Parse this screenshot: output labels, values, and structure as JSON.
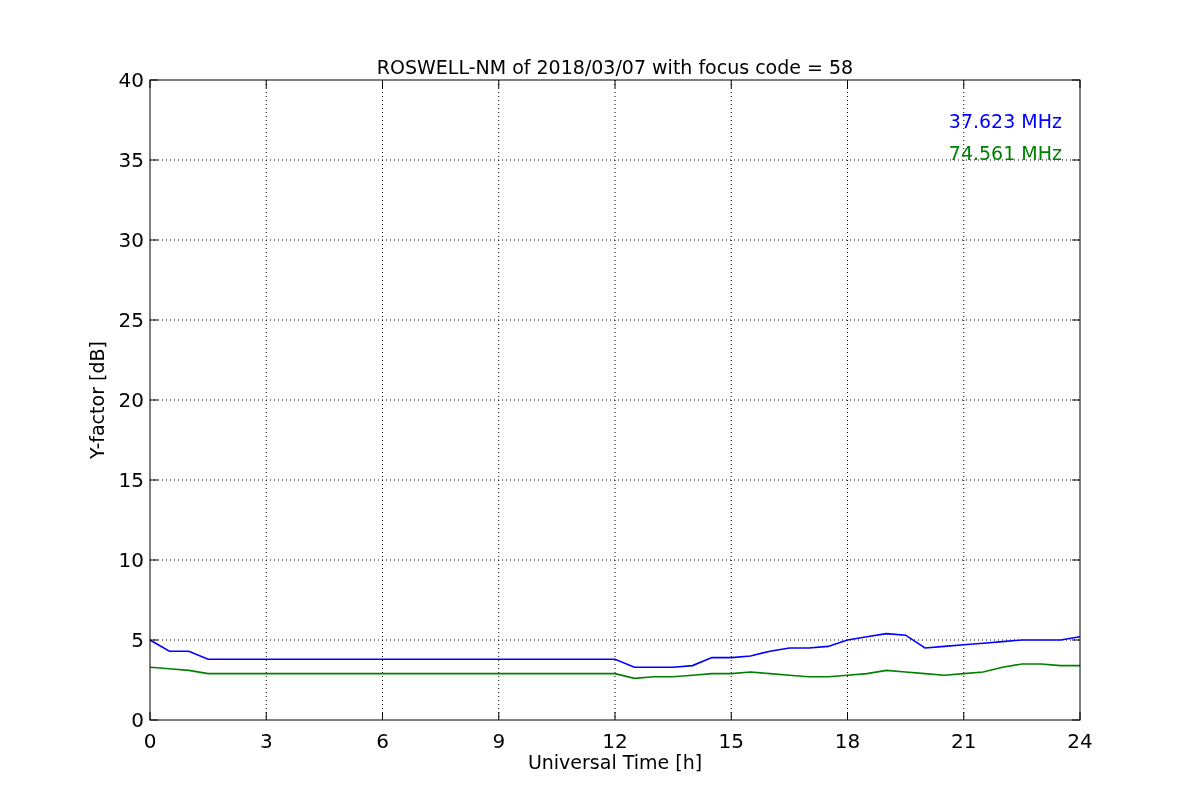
{
  "chart_data": {
    "type": "line",
    "title": "ROSWELL-NM of 2018/03/07 with focus code = 58",
    "xlabel": "Universal Time [h]",
    "ylabel": "Y-factor [dB]",
    "x": [
      0,
      0.5,
      1,
      1.5,
      2,
      2.5,
      3,
      3.5,
      4,
      4.5,
      5,
      5.5,
      6,
      6.5,
      7,
      7.5,
      8,
      8.5,
      9,
      9.5,
      10,
      10.5,
      11,
      11.5,
      12,
      12.5,
      13,
      13.5,
      14,
      14.5,
      15,
      15.5,
      16,
      16.5,
      17,
      17.5,
      18,
      18.5,
      19,
      19.5,
      20,
      20.5,
      21,
      21.5,
      22,
      22.5,
      23,
      23.5,
      24
    ],
    "series": [
      {
        "name": "37.623 MHz",
        "color": "#0000ff",
        "values": [
          5.0,
          4.3,
          4.3,
          3.8,
          3.8,
          3.8,
          3.8,
          3.8,
          3.8,
          3.8,
          3.8,
          3.8,
          3.8,
          3.8,
          3.8,
          3.8,
          3.8,
          3.8,
          3.8,
          3.8,
          3.8,
          3.8,
          3.8,
          3.8,
          3.8,
          3.3,
          3.3,
          3.3,
          3.4,
          3.9,
          3.9,
          4.0,
          4.3,
          4.5,
          4.5,
          4.6,
          5.0,
          5.2,
          5.4,
          5.3,
          4.5,
          4.6,
          4.7,
          4.8,
          4.9,
          5.0,
          5.0,
          5.0,
          5.2
        ]
      },
      {
        "name": "74.561 MHz",
        "color": "#008000",
        "values": [
          3.3,
          3.2,
          3.1,
          2.9,
          2.9,
          2.9,
          2.9,
          2.9,
          2.9,
          2.9,
          2.9,
          2.9,
          2.9,
          2.9,
          2.9,
          2.9,
          2.9,
          2.9,
          2.9,
          2.9,
          2.9,
          2.9,
          2.9,
          2.9,
          2.9,
          2.6,
          2.7,
          2.7,
          2.8,
          2.9,
          2.9,
          3.0,
          2.9,
          2.8,
          2.7,
          2.7,
          2.8,
          2.9,
          3.1,
          3.0,
          2.9,
          2.8,
          2.9,
          3.0,
          3.3,
          3.5,
          3.5,
          3.4,
          3.4
        ]
      }
    ],
    "xlim": [
      0,
      24
    ],
    "ylim": [
      0,
      40
    ],
    "grid": true,
    "xticks": [
      0,
      3,
      6,
      9,
      12,
      15,
      18,
      21,
      24
    ],
    "yticks": [
      0,
      5,
      10,
      15,
      20,
      25,
      30,
      35,
      40
    ]
  }
}
